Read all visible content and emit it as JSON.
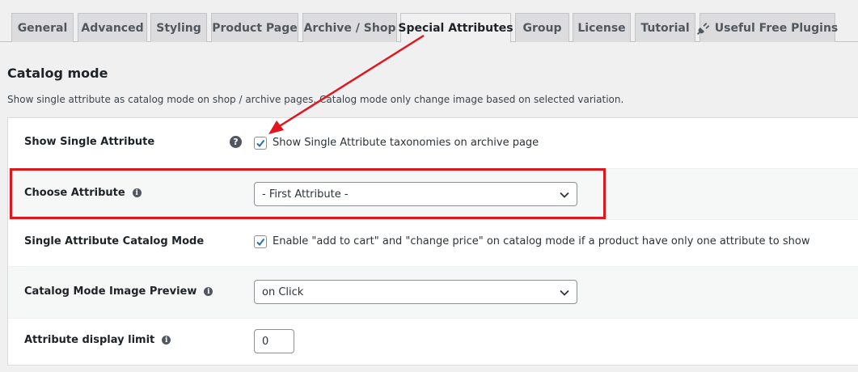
{
  "tabs": [
    {
      "label": "General",
      "active": false
    },
    {
      "label": "Advanced",
      "active": false
    },
    {
      "label": "Styling",
      "active": false
    },
    {
      "label": "Product Page",
      "active": false
    },
    {
      "label": "Archive / Shop",
      "active": false
    },
    {
      "label": "Special Attributes",
      "active": true
    },
    {
      "label": "Group",
      "active": false
    },
    {
      "label": "License",
      "active": false
    },
    {
      "label": "Tutorial",
      "active": false
    },
    {
      "label": "Useful Free Plugins",
      "active": false,
      "icon": "plug-icon"
    }
  ],
  "section": {
    "title": "Catalog mode",
    "description": "Show single attribute as catalog mode on shop / archive pages. Catalog mode only change image based on selected variation."
  },
  "settings": {
    "show_single_attribute": {
      "label": "Show Single Attribute",
      "help_icon": "question-icon",
      "checked": true,
      "checkbox_label": "Show Single Attribute taxonomies on archive page"
    },
    "choose_attribute": {
      "label": "Choose Attribute",
      "info_icon": "info-icon",
      "selected": "- First Attribute -"
    },
    "single_attribute_catalog_mode": {
      "label": "Single Attribute Catalog Mode",
      "checked": true,
      "checkbox_label": "Enable \"add to cart\" and \"change price\" on catalog mode if a product have only one attribute to show"
    },
    "catalog_mode_image_preview": {
      "label": "Catalog Mode Image Preview",
      "info_icon": "info-icon",
      "selected": "on Click"
    },
    "attribute_display_limit": {
      "label": "Attribute display limit",
      "info_icon": "info-icon",
      "value": "0"
    }
  },
  "annotations": {
    "arrow_color": "#e0161e",
    "highlight_color": "#e0161e"
  },
  "colors": {
    "checkbox_accent": "#2271b1",
    "background": "#f0f0f1",
    "panel": "#ffffff"
  }
}
